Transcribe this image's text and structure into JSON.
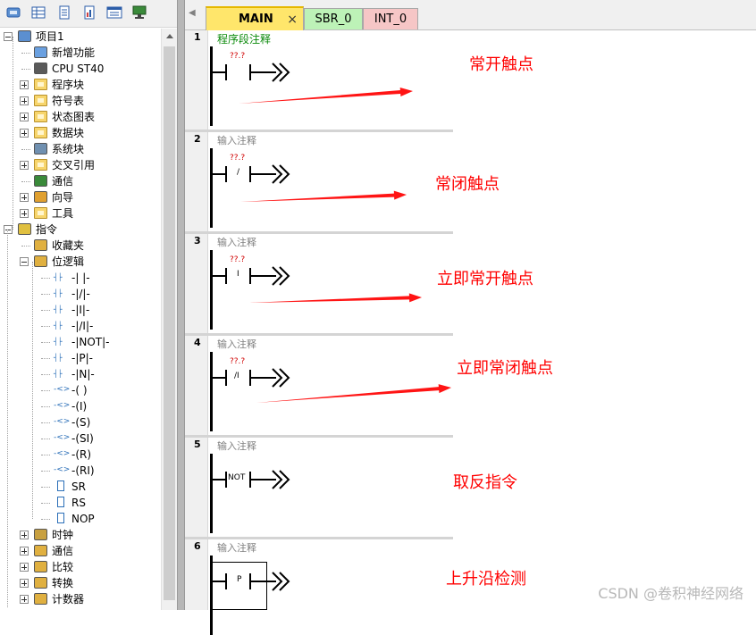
{
  "toolbar": {
    "buttons": [
      "project-icon",
      "table-icon",
      "doc-icon",
      "chart-icon",
      "report-icon",
      "monitor-icon"
    ]
  },
  "tree": {
    "items": [
      {
        "label": "项目1",
        "icon": "project-icon",
        "expander": "minus",
        "level": 0
      },
      {
        "label": "新增功能",
        "icon": "new-feature-icon",
        "expander": "",
        "level": 1
      },
      {
        "label": "CPU ST40",
        "icon": "cpu-icon",
        "expander": "",
        "level": 1
      },
      {
        "label": "程序块",
        "icon": "folder-icon",
        "expander": "plus",
        "level": 1
      },
      {
        "label": "符号表",
        "icon": "folder-icon",
        "expander": "plus",
        "level": 1
      },
      {
        "label": "状态图表",
        "icon": "folder-icon",
        "expander": "plus",
        "level": 1
      },
      {
        "label": "数据块",
        "icon": "folder-icon",
        "expander": "plus",
        "level": 1
      },
      {
        "label": "系统块",
        "icon": "system-block-icon",
        "expander": "",
        "level": 1
      },
      {
        "label": "交叉引用",
        "icon": "folder-icon",
        "expander": "plus",
        "level": 1
      },
      {
        "label": "通信",
        "icon": "comm-icon",
        "expander": "",
        "level": 1
      },
      {
        "label": "向导",
        "icon": "wizard-icon",
        "expander": "plus",
        "level": 1
      },
      {
        "label": "工具",
        "icon": "folder-icon",
        "expander": "plus",
        "level": 1
      },
      {
        "label": "指令",
        "icon": "instructions-icon",
        "expander": "minus",
        "level": 0
      },
      {
        "label": "收藏夹",
        "icon": "favorites-icon",
        "expander": "",
        "level": 1
      },
      {
        "label": "位逻辑",
        "icon": "bit-logic-icon",
        "expander": "minus",
        "level": 1
      },
      {
        "label": "-| |-",
        "icon": "contact-icon",
        "expander": "",
        "level": 2
      },
      {
        "label": "-|/|-",
        "icon": "contact-icon",
        "expander": "",
        "level": 2
      },
      {
        "label": "-|I|-",
        "icon": "contact-icon",
        "expander": "",
        "level": 2
      },
      {
        "label": "-|/I|-",
        "icon": "contact-icon",
        "expander": "",
        "level": 2
      },
      {
        "label": "-|NOT|-",
        "icon": "contact-icon",
        "expander": "",
        "level": 2
      },
      {
        "label": "-|P|-",
        "icon": "contact-icon",
        "expander": "",
        "level": 2
      },
      {
        "label": "-|N|-",
        "icon": "contact-icon",
        "expander": "",
        "level": 2
      },
      {
        "label": "-( )",
        "icon": "coil-icon",
        "expander": "",
        "level": 2
      },
      {
        "label": "-(I)",
        "icon": "coil-icon",
        "expander": "",
        "level": 2
      },
      {
        "label": "-(S)",
        "icon": "coil-icon",
        "expander": "",
        "level": 2
      },
      {
        "label": "-(SI)",
        "icon": "coil-icon",
        "expander": "",
        "level": 2
      },
      {
        "label": "-(R)",
        "icon": "coil-icon",
        "expander": "",
        "level": 2
      },
      {
        "label": "-(RI)",
        "icon": "coil-icon",
        "expander": "",
        "level": 2
      },
      {
        "label": "SR",
        "icon": "box-icon",
        "expander": "",
        "level": 2
      },
      {
        "label": "RS",
        "icon": "box-icon",
        "expander": "",
        "level": 2
      },
      {
        "label": "NOP",
        "icon": "box-icon",
        "expander": "",
        "level": 2
      },
      {
        "label": "时钟",
        "icon": "clock-icon",
        "expander": "plus",
        "level": 1
      },
      {
        "label": "通信",
        "icon": "comm-folder-icon",
        "expander": "plus",
        "level": 1
      },
      {
        "label": "比较",
        "icon": "compare-icon",
        "expander": "plus",
        "level": 1
      },
      {
        "label": "转换",
        "icon": "convert-icon",
        "expander": "plus",
        "level": 1
      },
      {
        "label": "计数器",
        "icon": "counter-icon",
        "expander": "plus",
        "level": 1
      }
    ]
  },
  "tabs": [
    {
      "label": "MAIN",
      "close": "×",
      "color": "#ffe66b"
    },
    {
      "label": "SBR_0",
      "color": "#bdf2b7"
    },
    {
      "label": "INT_0",
      "color": "#f6c6c6"
    }
  ],
  "networks": [
    {
      "num": "1",
      "comment": "程序段注释",
      "tag": "??.?",
      "symbol": "",
      "annotation": "常开触点"
    },
    {
      "num": "2",
      "comment": "输入注释",
      "tag": "??.?",
      "symbol": "/",
      "annotation": "常闭触点"
    },
    {
      "num": "3",
      "comment": "输入注释",
      "tag": "??.?",
      "symbol": "I",
      "annotation": "立即常开触点"
    },
    {
      "num": "4",
      "comment": "输入注释",
      "tag": "??.?",
      "symbol": "/I",
      "annotation": "立即常闭触点"
    },
    {
      "num": "5",
      "comment": "输入注释",
      "tag": "",
      "symbol": "NOT",
      "annotation": "取反指令"
    },
    {
      "num": "6",
      "comment": "输入注释",
      "tag": "",
      "symbol": "P",
      "annotation": "上升沿检测"
    }
  ],
  "watermark": "CSDN @卷积神经网络",
  "colors": {
    "annotation": "#ff0000",
    "tag": "#d00000",
    "comment_first": "#0a8a0a"
  }
}
